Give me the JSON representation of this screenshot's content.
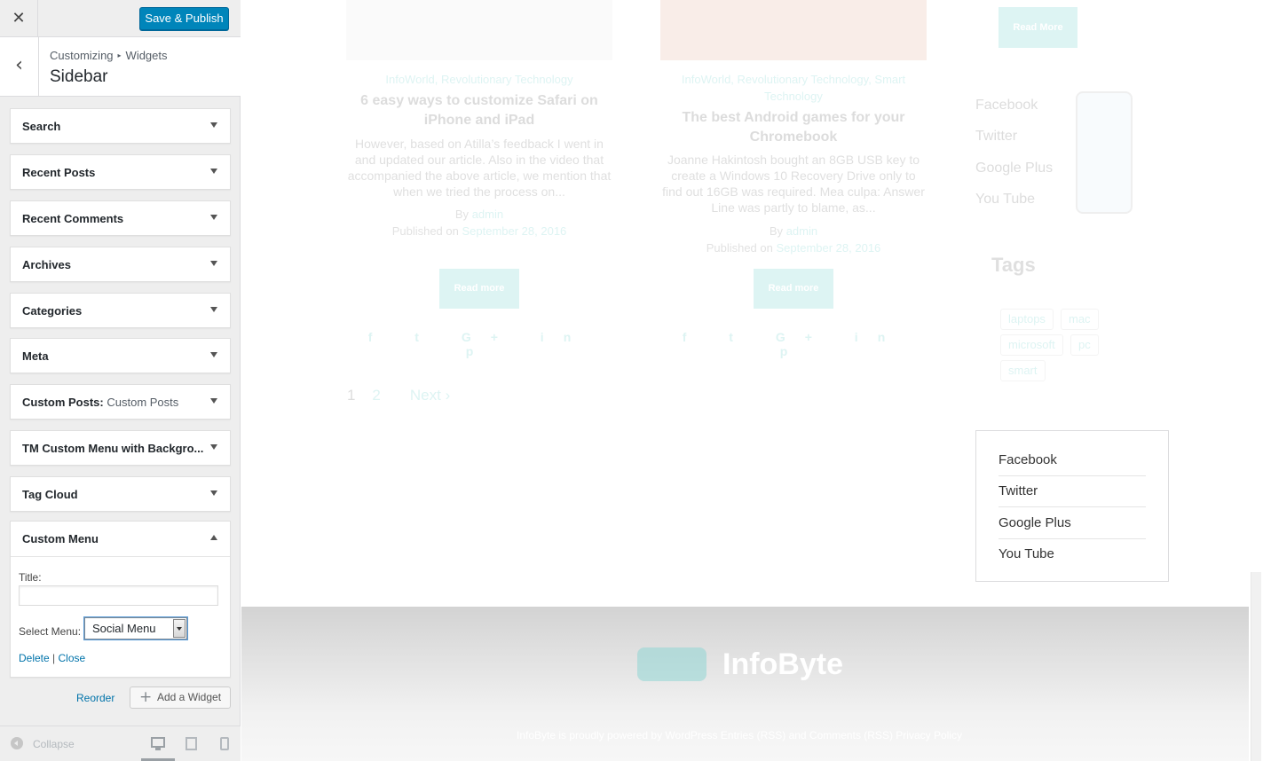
{
  "customizer": {
    "close_label": "✕",
    "publish_label": "Save & Publish",
    "back_label": "‹",
    "breadcrumb": {
      "part1": "Customizing",
      "separator": "▸",
      "part2": "Widgets"
    },
    "section_title": "Sidebar",
    "widgets": [
      {
        "label": "Search"
      },
      {
        "label": "Recent Posts"
      },
      {
        "label": "Recent Comments"
      },
      {
        "label": "Archives"
      },
      {
        "label": "Categories"
      },
      {
        "label": "Meta"
      },
      {
        "label": "Custom Posts:",
        "sub": "Custom Posts"
      },
      {
        "label": "TM Custom Menu with Backgro..."
      },
      {
        "label": "Tag Cloud"
      }
    ],
    "custom_menu": {
      "label": "Custom Menu",
      "title_label": "Title:",
      "title_value": "",
      "select_label": "Select Menu:",
      "select_value": "Social Menu",
      "delete_label": "Delete",
      "divider": "|",
      "close_label": "Close"
    },
    "reorder_label": "Reorder",
    "add_widget": {
      "icon": "plus-icon",
      "label": "Add a Widget"
    },
    "collapse_label": "Collapse"
  },
  "preview": {
    "posts": [
      {
        "categories": "InfoWorld, Revolutionary Technology",
        "title": "6 easy ways to customize Safari on iPhone and iPad",
        "excerpt": "However, based on Atilla’s feedback I went in and updated our article. Also in the video that accompanied the above article, we mention that when we tried the process on...",
        "by": "By",
        "author": "admin",
        "published": "Published on",
        "date": "September 28, 2016",
        "read_more": "Read more",
        "social": "f t G+ in p"
      },
      {
        "categories": "InfoWorld, Revolutionary Technology, Smart Technology",
        "title": "The best Android games for your Chromebook",
        "excerpt": "Joanne Hakintosh bought an 8GB USB key to create a Windows 10 Recovery Drive only to find out 16GB was required. Mea culpa: Answer Line was partly to blame, as...",
        "by": "By",
        "author": "admin",
        "published": "Published on",
        "date": "September 28, 2016",
        "read_more": "Read more",
        "social": "f t G+ in p"
      }
    ],
    "pager": {
      "p1": "1",
      "p2": "2",
      "next": "Next ›"
    },
    "sidebar": {
      "read_more": "Read More",
      "faded_links": [
        "Facebook",
        "Twitter",
        "Google Plus",
        "You Tube"
      ],
      "tags_title": "Tags",
      "tags": [
        "laptops",
        "mac",
        "microsoft",
        "pc",
        "smart"
      ],
      "social_menu": [
        "Facebook",
        "Twitter",
        "Google Plus",
        "You Tube"
      ]
    },
    "footer": {
      "logo_text": "InfoByte",
      "credits": "InfoByte is proudly powered by WordPress Entries (RSS) and Comments (RSS) Privacy Policy"
    }
  },
  "colors": {
    "accent": "#29b6b0",
    "publish_button": "#0085ba",
    "link": "#0073aa"
  }
}
